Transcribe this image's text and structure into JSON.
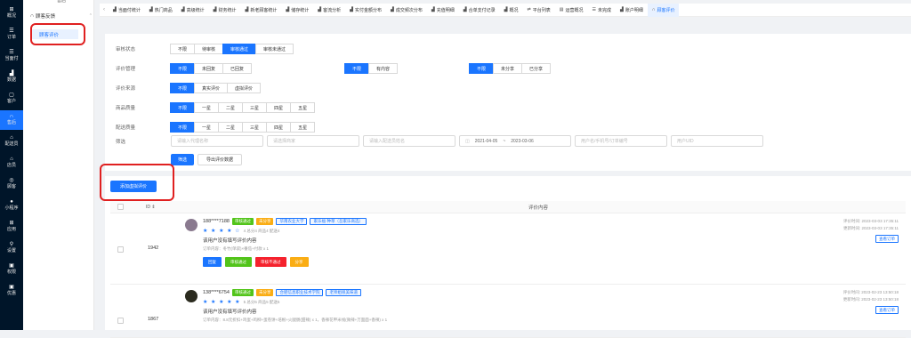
{
  "rail": [
    {
      "icon": "⊞",
      "label": "概况"
    },
    {
      "icon": "☰",
      "label": "订单"
    },
    {
      "icon": "☰",
      "label": "当面付"
    },
    {
      "icon": "▟",
      "label": "数据"
    },
    {
      "icon": "▢",
      "label": "客户"
    },
    {
      "icon": "∩",
      "label": "售后"
    },
    {
      "icon": "⌂",
      "label": "配送员"
    },
    {
      "icon": "⌂",
      "label": "店员"
    },
    {
      "icon": "◎",
      "label": "顾客"
    },
    {
      "icon": "●",
      "label": "小程序"
    },
    {
      "icon": "⊞",
      "label": "应用"
    },
    {
      "icon": "⚲",
      "label": "设置"
    },
    {
      "icon": "▣",
      "label": "权限"
    },
    {
      "icon": "▣",
      "label": "优惠"
    }
  ],
  "sub": {
    "cut": "售后",
    "group": "顾客反馈",
    "active": "顾客评价"
  },
  "tabs": [
    {
      "icon": "▟",
      "label": "当面付统计"
    },
    {
      "icon": "▟",
      "label": "热门商品"
    },
    {
      "icon": "▟",
      "label": "高级统计"
    },
    {
      "icon": "▟",
      "label": "财务统计"
    },
    {
      "icon": "▟",
      "label": "新老顾客统计"
    },
    {
      "icon": "▟",
      "label": "储存统计"
    },
    {
      "icon": "▟",
      "label": "客流分析"
    },
    {
      "icon": "▟",
      "label": "实付金额分布"
    },
    {
      "icon": "▟",
      "label": "成交频次分布"
    },
    {
      "icon": "▟",
      "label": "充值明细"
    },
    {
      "icon": "▟",
      "label": "合单支付记录"
    },
    {
      "icon": "▟",
      "label": "概况"
    },
    {
      "icon": "⇄",
      "label": "平台列表"
    },
    {
      "icon": "▤",
      "label": "运营概况"
    },
    {
      "icon": "☰",
      "label": "未完成"
    },
    {
      "icon": "▟",
      "label": "账户明细"
    },
    {
      "icon": "∩",
      "label": "顾客评价"
    }
  ],
  "filters": [
    {
      "label": "审核状态",
      "groups": [
        [
          "不限",
          "待审核",
          "审核通过",
          "审核未通过"
        ]
      ],
      "on": [
        2
      ]
    },
    {
      "label": "评价管理",
      "groups": [
        [
          "不限",
          "未回复",
          "已回复"
        ],
        [
          "不限",
          "有内容"
        ],
        [
          "不限",
          "未分享",
          "已分享"
        ]
      ],
      "on": [
        0,
        0,
        0
      ]
    },
    {
      "label": "评价来源",
      "groups": [
        [
          "不限",
          "真实评价",
          "虚拟评价"
        ]
      ],
      "on": [
        0
      ]
    },
    {
      "label": "商品质量",
      "groups": [
        [
          "不限",
          "一星",
          "二星",
          "三星",
          "四星",
          "五星"
        ]
      ],
      "on": [
        0
      ]
    },
    {
      "label": "配送质量",
      "groups": [
        [
          "不限",
          "一星",
          "二星",
          "三星",
          "四星",
          "五星"
        ]
      ],
      "on": [
        0
      ]
    }
  ],
  "search": {
    "label": "筛选",
    "agent_ph": "请输入代理名称",
    "merchant_ph": "请选择商家",
    "courier_ph": "请输入配送员姓名",
    "date_from": "2021-04-05",
    "date_sep": "~",
    "date_to": "2023-03-06",
    "user_ph": "用户名/手机号/订单编号",
    "uid_ph": "用户UID",
    "filter_btn": "筛选",
    "export_btn": "导出评价数据"
  },
  "add_btn": "添加虚拟评价",
  "table": {
    "id_header": "ID ⇕",
    "content_header": "评价内容"
  },
  "rows": [
    {
      "id": "1942",
      "user": "188****7188",
      "tags": [
        {
          "t": "审核通过",
          "c": "#52c41a"
        },
        {
          "t": "未分享",
          "c": "#faad14"
        },
        {
          "t": "华南农业大学",
          "c": "#1a75ff"
        },
        {
          "t": "家乐福·种草（吾家乐商选）",
          "c": "#1a75ff"
        }
      ],
      "stars": "★ ★ ★ ★ ☆",
      "meta": "4  总分4  商品4  配送4",
      "content": "该用户没有填写评价内容",
      "order": "订单内容：冬竹(单袋)×番茄+付款 x 1",
      "actions": [
        {
          "t": "回复",
          "c": "#1a75ff"
        },
        {
          "t": "审核通过",
          "c": "#52c41a"
        },
        {
          "t": "审核不通过",
          "c": "#f5222d"
        },
        {
          "t": "分享",
          "c": "#faad14"
        }
      ],
      "time1": "评价时间: 2023-03-03 17:35:11",
      "time2": "更新时间: 2023-03-03 17:35:11",
      "view": "查看订单"
    },
    {
      "id": "1867",
      "user": "138****6754",
      "tags": [
        {
          "t": "审核通过",
          "c": "#52c41a"
        },
        {
          "t": "未分享",
          "c": "#faad14"
        },
        {
          "t": "合肥信息职业技术学院",
          "c": "#1a75ff"
        },
        {
          "t": "老师姐很美味道",
          "c": "#1a75ff"
        }
      ],
      "stars": "★ ★ ★ ★ ★",
      "meta": "5  总分5  商品5  配送5",
      "content": "该用户没有填写评价内容",
      "order": "订单内容：8.8元折扣+鸡蛋+鸡柳+蛋卷饼+培根+火腿肠(甜辣) x 1，香辣花甲米线(微辣+万面面+香辣) x 1",
      "time1": "评价时间: 2023-02-23 13:50:18",
      "time2": "更新时间: 2023-02-23 13:50:18",
      "view": "查看订单"
    }
  ]
}
